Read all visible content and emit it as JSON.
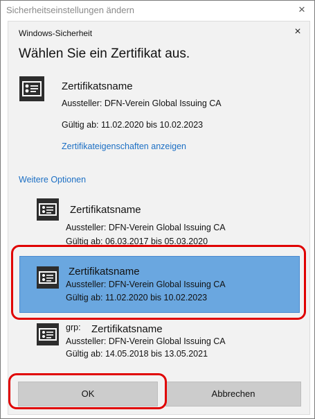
{
  "window": {
    "title": "Sicherheitseinstellungen ändern",
    "close": "×"
  },
  "dialog": {
    "title": "Windows-Sicherheit",
    "close": "×",
    "heading": "Wählen Sie ein Zertifikat aus.",
    "primary": {
      "name": "Zertifikatsname",
      "issuer": "Aussteller: DFN-Verein Global Issuing CA",
      "valid": "Gültig ab: 11.02.2020 bis 10.02.2023",
      "properties_link": "Zertifikateigenschaften anzeigen"
    },
    "more_options": "Weitere Optionen",
    "options": [
      {
        "prefix": "",
        "name": "Zertifikatsname",
        "issuer": "Aussteller: DFN-Verein Global Issuing CA",
        "valid": "Gültig ab: 06.03.2017 bis 05.03.2020"
      },
      {
        "prefix": "",
        "name": "Zertifikatsname",
        "issuer": "Aussteller: DFN-Verein Global Issuing CA",
        "valid": "Gültig ab: 11.02.2020 bis 10.02.2023"
      },
      {
        "prefix": "grp:",
        "name": "Zertifikatsname",
        "issuer": "Aussteller: DFN-Verein Global Issuing CA",
        "valid": "Gültig ab: 14.05.2018 bis 13.05.2021"
      }
    ],
    "buttons": {
      "ok": "OK",
      "cancel": "Abbrechen"
    }
  },
  "colors": {
    "selected": "#6aa7e0",
    "link": "#1c6fc4",
    "highlight": "#e00000"
  },
  "icons": {
    "certificate": "certificate-icon"
  }
}
